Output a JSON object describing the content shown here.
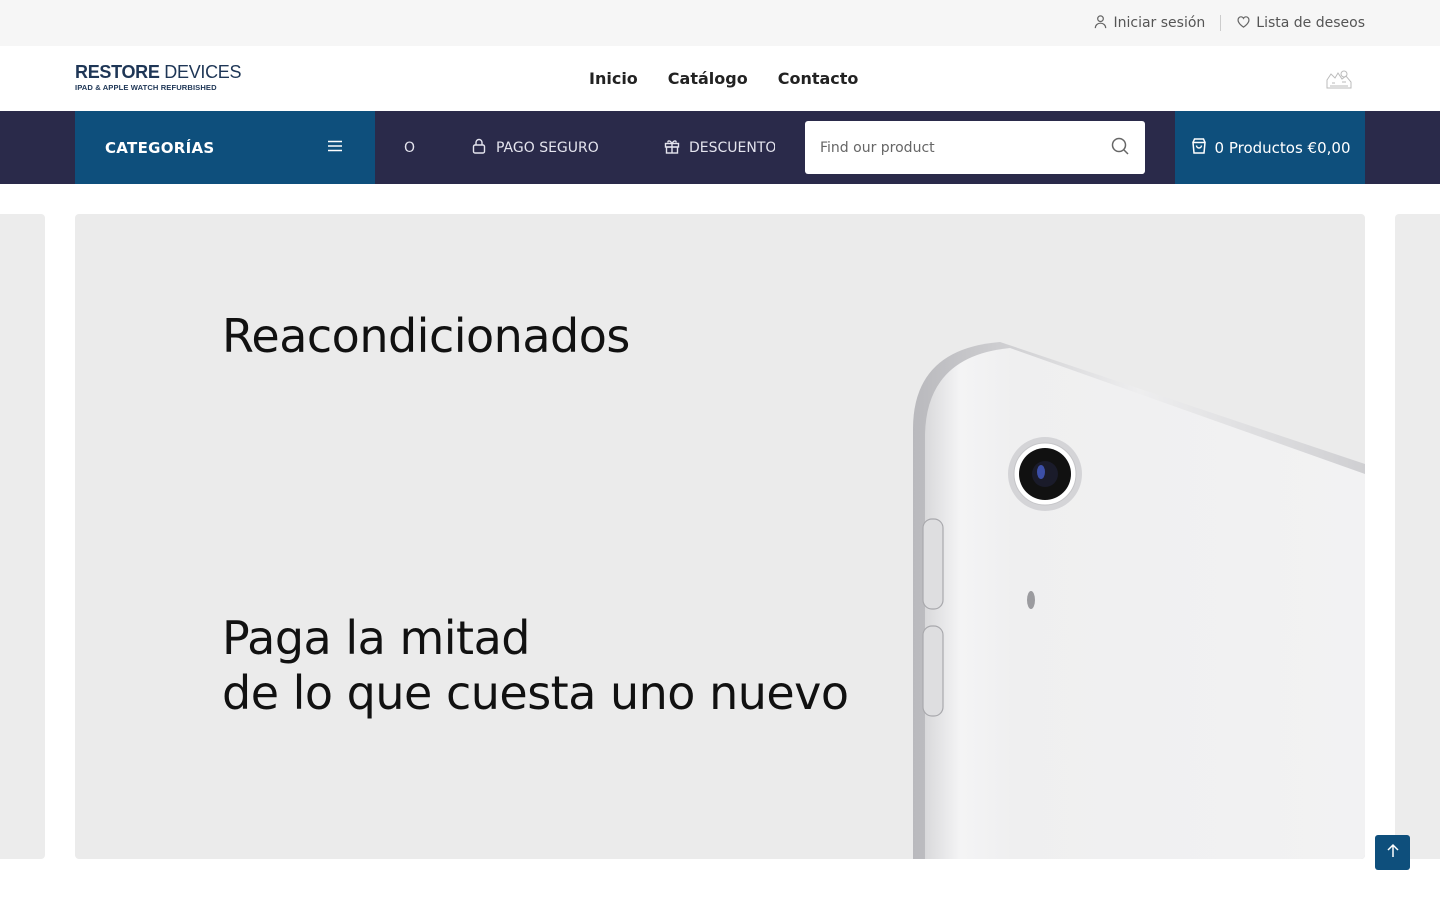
{
  "topbar": {
    "login_label": "Iniciar sesión",
    "wishlist_label": "Lista de deseos"
  },
  "logo": {
    "main_bold": "RESTORE",
    "main_light": " DEVICES",
    "sub": "IPAD & APPLE WATCH REFURBISHED"
  },
  "nav": {
    "items": [
      {
        "label": "Inicio"
      },
      {
        "label": "Catálogo"
      },
      {
        "label": "Contacto"
      }
    ]
  },
  "strip": {
    "categories_label": "CATEGORÍAS",
    "marquee": [
      {
        "icon": "truck-icon",
        "label": "O"
      },
      {
        "icon": "lock-icon",
        "label": "PAGO SEGURO"
      },
      {
        "icon": "gift-icon",
        "label": "DESCUENTOS"
      }
    ],
    "search_placeholder": "Find our product",
    "cart_label": "0 Productos €0,00"
  },
  "hero": {
    "title": "Reacondicionados",
    "line1": "Paga la mitad",
    "line2": "de lo que cuesta uno nuevo"
  },
  "colors": {
    "strip_bg": "#2a2a4a",
    "accent_blue": "#0e4f7c",
    "hero_bg": "#ebebeb"
  }
}
